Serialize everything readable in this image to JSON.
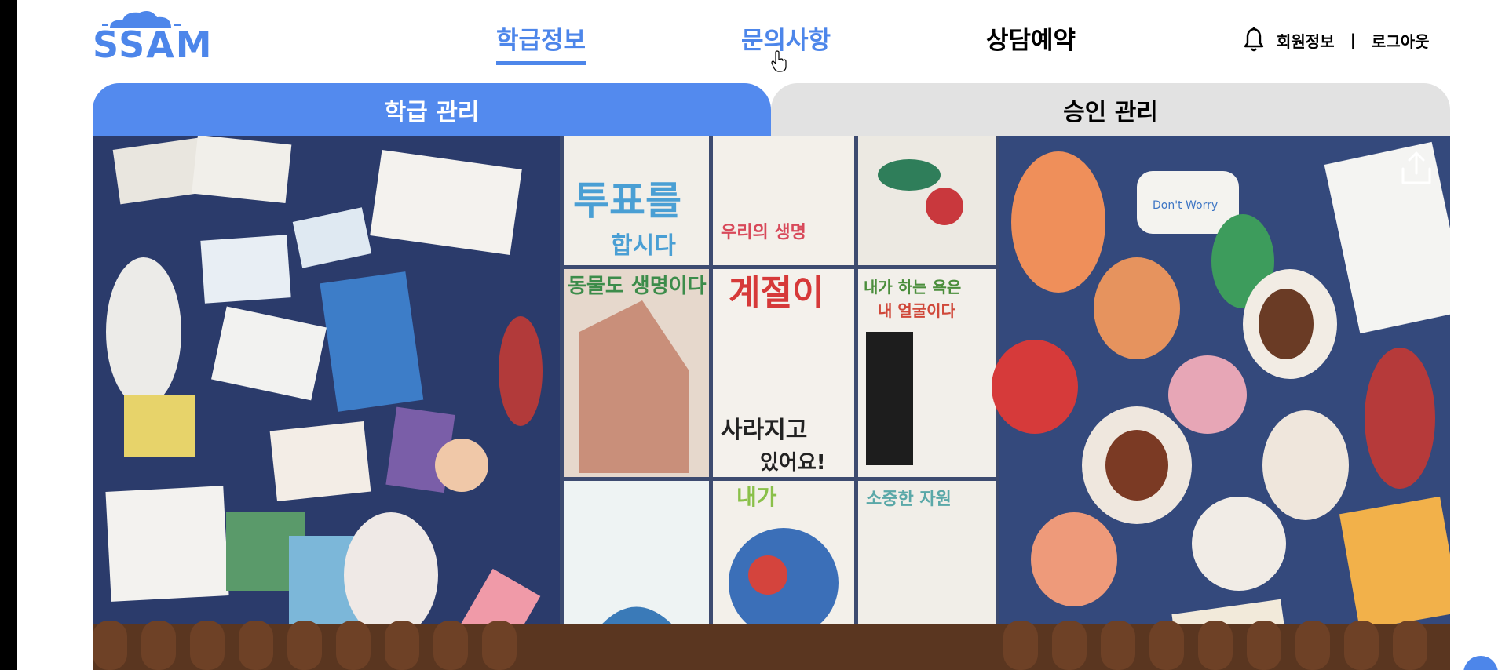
{
  "header": {
    "logo": "SSAM",
    "nav": [
      {
        "label": "학급정보"
      },
      {
        "label": "문의사항"
      },
      {
        "label": "상담예약"
      }
    ],
    "user": {
      "profile_label": "회원정보",
      "separator": "|",
      "logout_label": "로그아웃"
    }
  },
  "tabs": [
    {
      "label": "학급 관리"
    },
    {
      "label": "승인 관리"
    }
  ],
  "banner": {
    "posters": [
      {
        "text": "투표를"
      },
      {
        "text": "합시다"
      },
      {
        "text": "우리의 생명"
      },
      {
        "text": "동물도 생명이다"
      },
      {
        "text": "계절이"
      },
      {
        "text": "사라지고"
      },
      {
        "text": "있어요!"
      },
      {
        "text": "내가 하는 욕은"
      },
      {
        "text": "내 얼굴이다"
      },
      {
        "text": "내가"
      },
      {
        "text": "소중한 자원"
      }
    ],
    "card_text": "Don't Worry"
  },
  "colors": {
    "accent": "#4d86ea",
    "tab_active": "#538aee",
    "tab_inactive": "#e2e2e2"
  },
  "icons": {
    "bell": "bell-icon",
    "share": "share-icon"
  }
}
